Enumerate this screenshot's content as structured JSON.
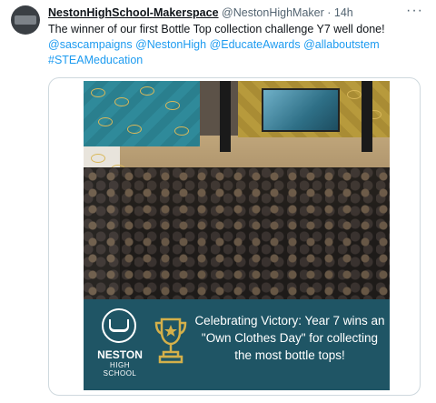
{
  "tweet": {
    "display_name": "NestonHighSchool-Makerspace",
    "handle": "@NestonHighMaker",
    "separator": "·",
    "time": "14h",
    "more_label": "···",
    "text_plain": "The winner of our first Bottle Top collection challenge Y7 well done!",
    "mentions": [
      "@sascampaigns",
      "@NestonHigh",
      "@EducateAwards",
      "@allaboutstem"
    ],
    "hashtag": "#STEAMeducation"
  },
  "media": {
    "banner_text": "Celebrating Victory: Year 7 wins an \"Own Clothes Day\" for collecting the most bottle tops!",
    "school_name": "NESTON",
    "school_sub": "HIGH SCHOOL"
  },
  "colors": {
    "link": "#1d9bf0",
    "banner": "#1f5565",
    "trophy": "#d4b04a"
  }
}
